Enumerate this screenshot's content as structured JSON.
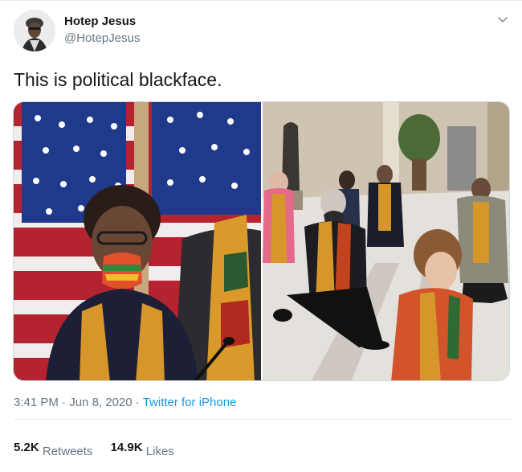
{
  "tweet": {
    "author_name": "Hotep Jesus",
    "author_handle": "@HotepJesus",
    "text": "This is political blackface.",
    "time": "3:41 PM",
    "date": "Jun 8, 2020",
    "separator": "·",
    "source": "Twitter for iPhone"
  },
  "stats": {
    "retweets_count": "5.2K",
    "retweets_label": "Retweets",
    "likes_count": "14.9K",
    "likes_label": "Likes"
  },
  "icons": {
    "menu": "chevron-down-icon",
    "avatar": "avatar"
  },
  "colors": {
    "text": "#14171a",
    "muted": "#657786",
    "link": "#1b95e0",
    "border": "#e6ecf0"
  }
}
